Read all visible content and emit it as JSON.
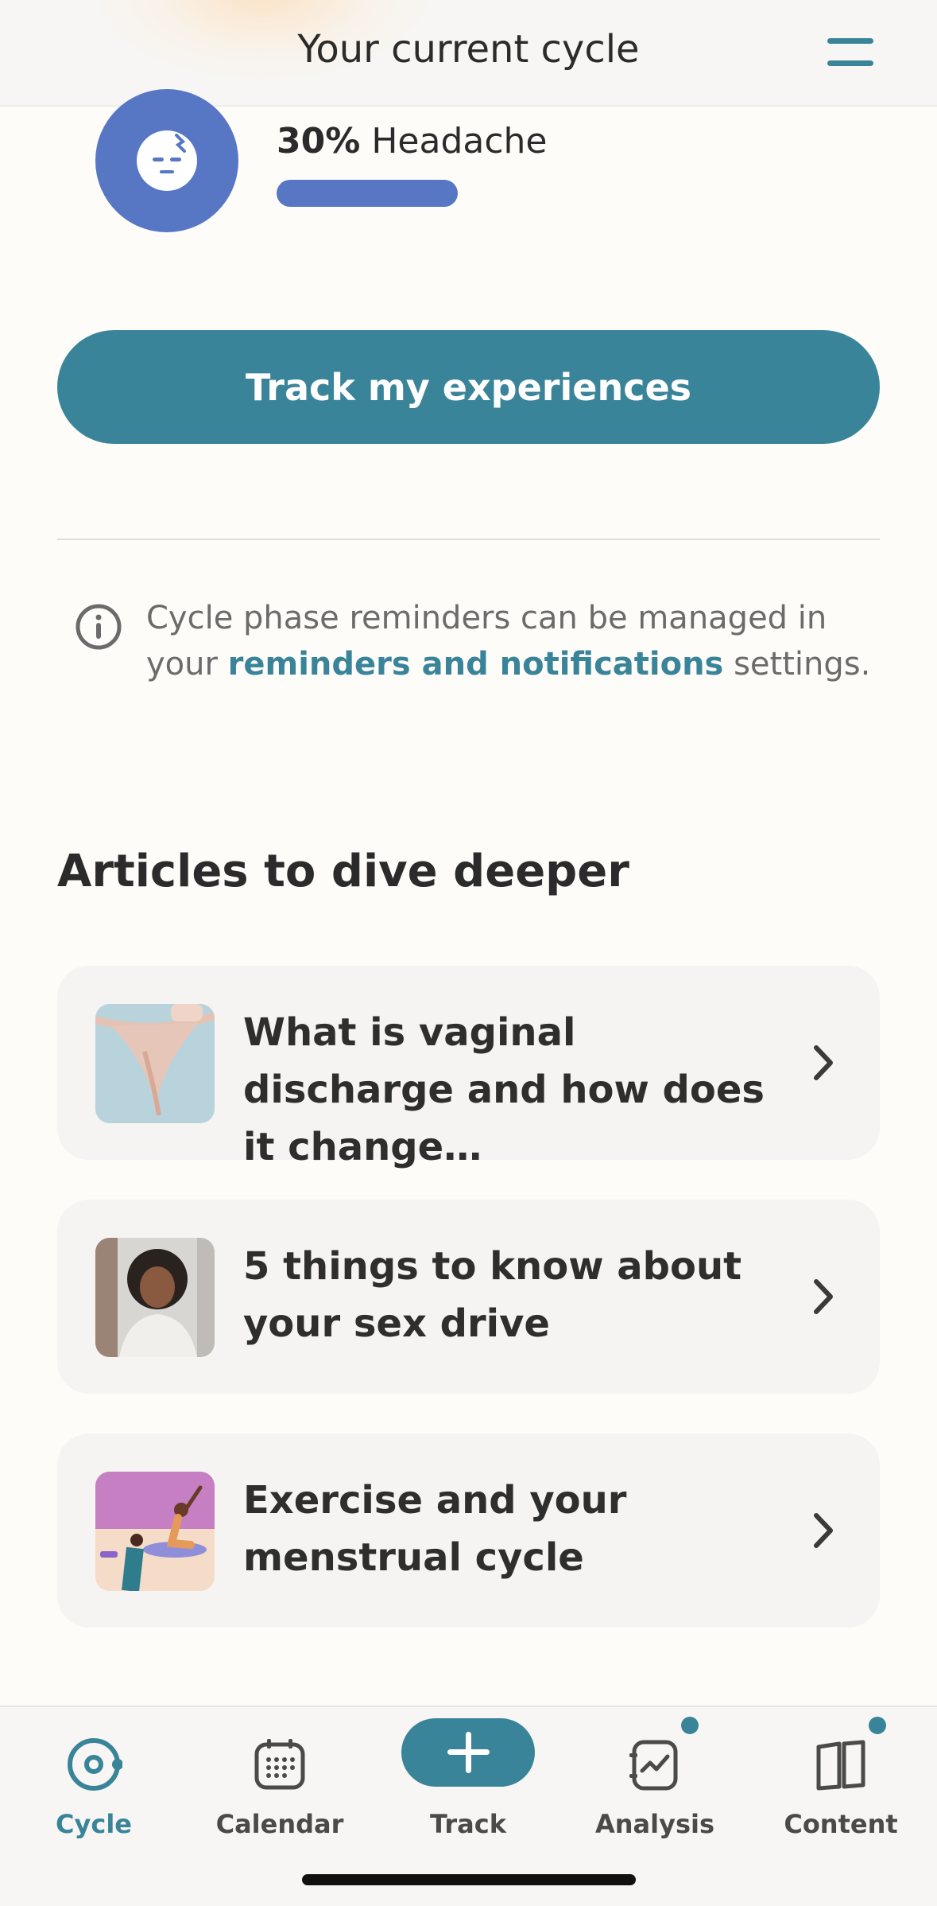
{
  "header": {
    "title": "Your current cycle"
  },
  "symptom": {
    "percent": "30%",
    "label": "Headache",
    "level": 0.3,
    "icon": "headache-face-icon",
    "color": "#5777c4"
  },
  "track_button": {
    "label": "Track my experiences"
  },
  "info": {
    "text_before": "Cycle phase reminders can be managed in your ",
    "link": "reminders and notifications",
    "text_after": " settings."
  },
  "articles": {
    "title": "Articles to dive deeper",
    "items": [
      {
        "title": "What is vaginal discharge and how does it change…"
      },
      {
        "title": "5 things to know about your sex drive"
      },
      {
        "title": "Exercise and your menstrual cycle"
      }
    ]
  },
  "tabbar": {
    "tabs": [
      {
        "label": "Cycle",
        "icon": "cycle-icon",
        "active": true
      },
      {
        "label": "Calendar",
        "icon": "calendar-icon",
        "active": false
      },
      {
        "label": "Track",
        "icon": "plus-icon",
        "active": false
      },
      {
        "label": "Analysis",
        "icon": "analysis-icon",
        "active": false,
        "badge": true
      },
      {
        "label": "Content",
        "icon": "book-icon",
        "active": false,
        "badge": true
      }
    ]
  },
  "colors": {
    "accent": "#3a8499",
    "symptom": "#5777c4",
    "background": "#fdfcf9",
    "card": "#f5f4f2"
  }
}
